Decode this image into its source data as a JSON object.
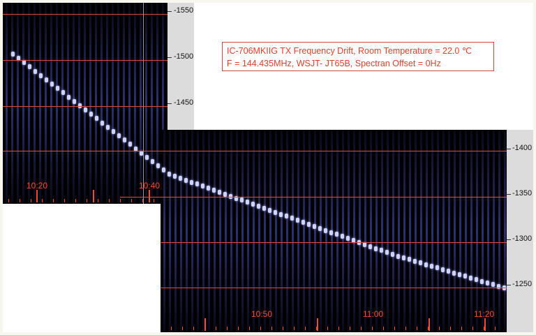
{
  "info_box": {
    "line1": "IC-706MKIIG TX Frequency Drift, Room Temperature = 22.0 ℃",
    "line2": "F = 144.435MHz, WSJT- JT65B, Spectran Offset = 0Hz"
  },
  "left_axis_ticks": [
    "-1550",
    "-1500",
    "-1450"
  ],
  "right_axis_ticks": [
    "-1400",
    "-1350",
    "-1300",
    "-1250"
  ],
  "left_time_labels": [
    "10:20",
    "10:40"
  ],
  "right_time_labels": [
    "10:50",
    "11:00",
    "11:20"
  ],
  "colors": {
    "grid_line": "#e34a3a",
    "time_label": "#ff4a2a",
    "signal": "#cfd3ff"
  }
}
